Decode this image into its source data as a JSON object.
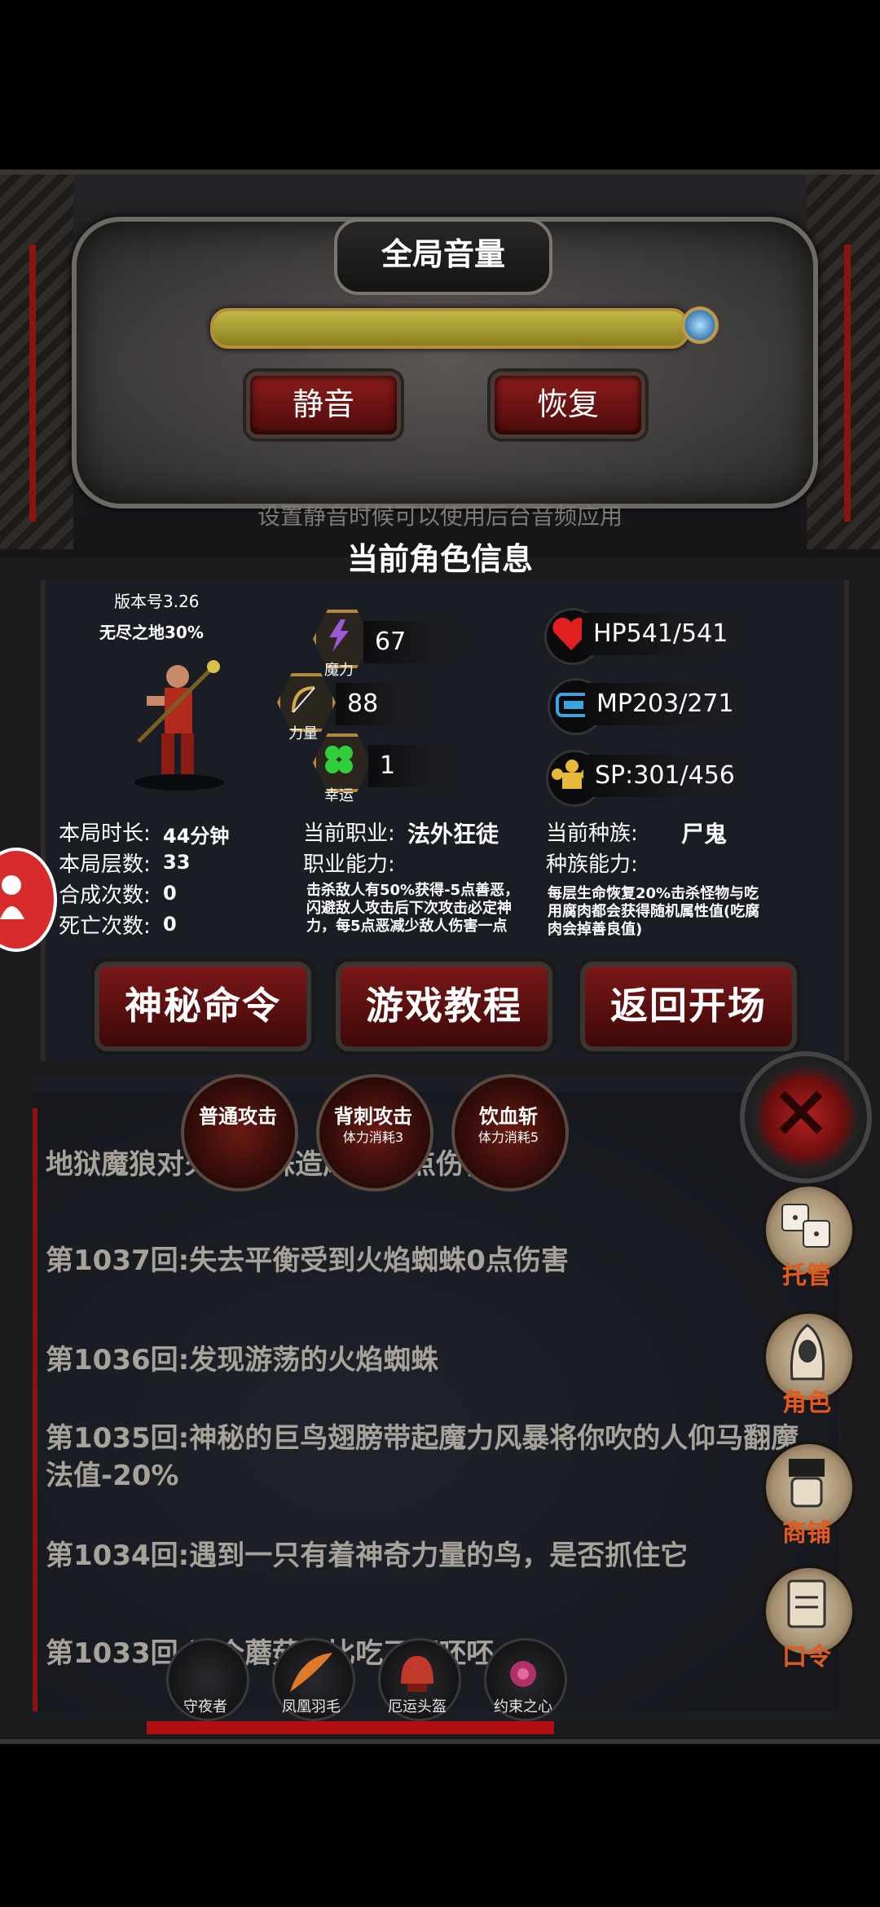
{
  "volume": {
    "title": "全局音量",
    "level": 0.97,
    "mute_label": "静音",
    "restore_label": "恢复",
    "hint": "设置静音时候可以使用后台音频应用"
  },
  "character": {
    "section_title": "当前角色信息",
    "version": "版本号3.26",
    "location": "无尽之地30%",
    "magic": {
      "label": "魔力",
      "value": "67"
    },
    "strength": {
      "label": "力量",
      "value": "88"
    },
    "luck": {
      "label": "幸运",
      "value": "1"
    },
    "hp": "HP541/541",
    "mp": "MP203/271",
    "sp": "SP:301/456",
    "duration_label": "本局时长:",
    "duration_value": "44分钟",
    "floors_label": "本局层数:",
    "floors_value": "33",
    "synth_label": "合成次数:",
    "synth_value": "0",
    "deaths_label": "死亡次数:",
    "deaths_value": "0",
    "class_label": "当前职业:",
    "class_value": "法外狂徒",
    "class_ability_label": "职业能力:",
    "class_ability_desc": "击杀敌人有50%获得-5点善恶，闪避敌人攻击后下次攻击必定神力，每5点恶减少敌人伤害一点",
    "race_label": "当前种族:",
    "race_value": "尸鬼",
    "race_ability_label": "种族能力:",
    "race_ability_desc": "每层生命恢复20%击杀怪物与吃用腐肉都会获得随机属性值(吃腐肉会掉善良值)"
  },
  "actions": {
    "secret_cmd": "神秘命令",
    "tutorial": "游戏教程",
    "back_to_start": "返回开场"
  },
  "skills": [
    {
      "name": "普通攻击",
      "cost": ""
    },
    {
      "name": "背刺攻击",
      "cost": "体力消耗3"
    },
    {
      "name": "饮血斩",
      "cost": "体力消耗5"
    }
  ],
  "log": [
    "地狱魔狼对火焰蜘蛛造成780点伤害",
    "第1037回:失去平衡受到火焰蜘蛛0点伤害",
    "第1036回:发现游荡的火焰蜘蛛",
    "第1035回:神秘的巨鸟翅膀带起魔力风暴将你吹的人仰马翻魔法值-20%",
    "第1034回:遇到一只有着神奇力量的鸟，是否抓住它",
    "第1033回:这个蘑菇好比吃了呸呸呸......"
  ],
  "side_menu": [
    "托管",
    "角色",
    "商铺",
    "口令"
  ],
  "items": [
    "守夜者",
    "凤凰羽毛",
    "厄运头盔",
    "约束之心"
  ],
  "colors": {
    "accent_red": "#8a1c1c",
    "side_label": "#e25a1c",
    "log_text": "#a7a29a"
  }
}
